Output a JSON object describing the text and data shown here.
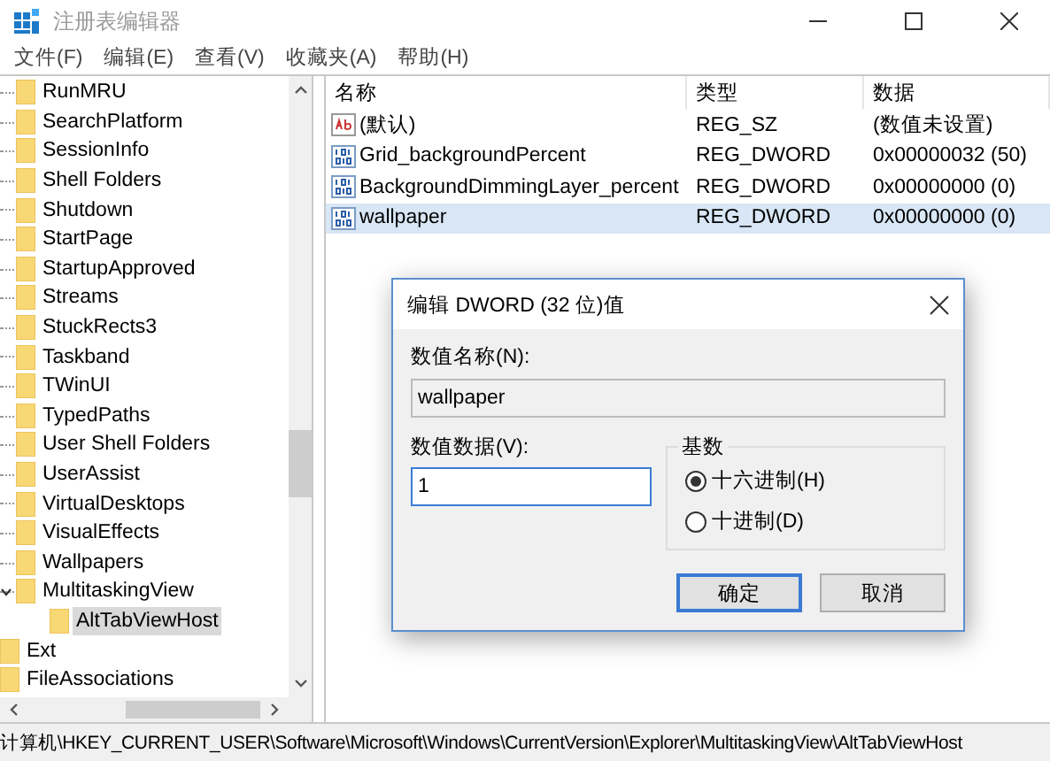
{
  "window": {
    "title": "注册表编辑器"
  },
  "menu": [
    "文件(F)",
    "编辑(E)",
    "查看(V)",
    "收藏夹(A)",
    "帮助(H)"
  ],
  "tree": {
    "items": [
      {
        "label": "RunMRU",
        "selected": false,
        "expanded": false
      },
      {
        "label": "SearchPlatform",
        "selected": false,
        "expanded": false
      },
      {
        "label": "SessionInfo",
        "selected": false,
        "expanded": false
      },
      {
        "label": "Shell Folders",
        "selected": false,
        "expanded": false
      },
      {
        "label": "Shutdown",
        "selected": false,
        "expanded": false
      },
      {
        "label": "StartPage",
        "selected": false,
        "expanded": false
      },
      {
        "label": "StartupApproved",
        "selected": false,
        "expanded": false
      },
      {
        "label": "Streams",
        "selected": false,
        "expanded": false
      },
      {
        "label": "StuckRects3",
        "selected": false,
        "expanded": false
      },
      {
        "label": "Taskband",
        "selected": false,
        "expanded": false
      },
      {
        "label": "TWinUI",
        "selected": false,
        "expanded": false
      },
      {
        "label": "TypedPaths",
        "selected": false,
        "expanded": false
      },
      {
        "label": "User Shell Folders",
        "selected": false,
        "expanded": false
      },
      {
        "label": "UserAssist",
        "selected": false,
        "expanded": false
      },
      {
        "label": "VirtualDesktops",
        "selected": false,
        "expanded": false
      },
      {
        "label": "VisualEffects",
        "selected": false,
        "expanded": false
      },
      {
        "label": "Wallpapers",
        "selected": false,
        "expanded": false
      },
      {
        "label": "MultitaskingView",
        "selected": false,
        "expanded": true,
        "children": [
          {
            "label": "AltTabViewHost",
            "selected": true,
            "expanded": false
          }
        ]
      }
    ],
    "parent_level_items": [
      {
        "label": "Ext",
        "selected": false,
        "expanded": false
      },
      {
        "label": "FileAssociations",
        "selected": false,
        "expanded": false
      }
    ]
  },
  "table": {
    "columns": [
      "名称",
      "类型",
      "数据"
    ],
    "rows": [
      {
        "kind": "string",
        "name": "(默认)",
        "type": "REG_SZ",
        "data": "(数值未设置)",
        "selected": false
      },
      {
        "kind": "dword",
        "name": "Grid_backgroundPercent",
        "type": "REG_DWORD",
        "data": "0x00000032 (50)",
        "selected": false
      },
      {
        "kind": "dword",
        "name": "BackgroundDimmingLayer_percent",
        "type": "REG_DWORD",
        "data": "0x00000000 (0)",
        "selected": false
      },
      {
        "kind": "dword",
        "name": "wallpaper",
        "type": "REG_DWORD",
        "data": "0x00000000 (0)",
        "selected": true
      }
    ]
  },
  "dialog": {
    "title": "编辑 DWORD (32 位)值",
    "name_label": "数值名称(N):",
    "name_value": "wallpaper",
    "data_label": "数值数据(V):",
    "data_value": "1",
    "base_group": "基数",
    "radios": [
      {
        "label": "十六进制(H)",
        "selected": true
      },
      {
        "label": "十进制(D)",
        "selected": false
      }
    ],
    "buttons": [
      {
        "label": "确定",
        "default": true
      },
      {
        "label": "取消",
        "default": false
      }
    ]
  },
  "status_bar": "计算机\\HKEY_CURRENT_USER\\Software\\Microsoft\\Windows\\CurrentVersion\\Explorer\\MultitaskingView\\AltTabViewHost"
}
